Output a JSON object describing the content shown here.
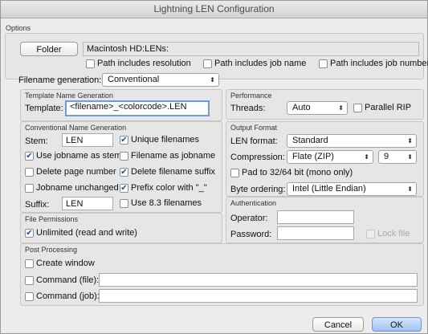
{
  "window": {
    "title": "Lightning LEN Configuration"
  },
  "options": {
    "section_label": "Options",
    "folder_button": "Folder",
    "folder_path": "Macintosh HD:LENs:",
    "path_includes_resolution": {
      "label": "Path includes resolution",
      "checked": false
    },
    "path_includes_job_name": {
      "label": "Path includes job name",
      "checked": false
    },
    "path_includes_job_number": {
      "label": "Path includes job number",
      "checked": false
    },
    "filename_generation_label": "Filename generation:",
    "filename_generation_value": "Conventional"
  },
  "template": {
    "title": "Template Name Generation",
    "label": "Template:",
    "value": "<filename>_<colorcode>.LEN"
  },
  "conventional": {
    "title": "Conventional Name Generation",
    "stem_label": "Stem:",
    "stem_value": "LEN",
    "unique_filenames": {
      "label": "Unique filenames",
      "checked": true
    },
    "use_jobname_as_stem": {
      "label": "Use jobname as stem",
      "checked": true
    },
    "filename_as_jobname": {
      "label": "Filename as jobname",
      "checked": false
    },
    "delete_page_number": {
      "label": "Delete page number",
      "checked": false
    },
    "delete_filename_suffix": {
      "label": "Delete filename suffix",
      "checked": true
    },
    "jobname_unchanged": {
      "label": "Jobname unchanged",
      "checked": false
    },
    "prefix_color": {
      "label": "Prefix color with \"_\"",
      "checked": true
    },
    "suffix_label": "Suffix:",
    "suffix_value": "LEN",
    "use_83": {
      "label": "Use 8.3 filenames",
      "checked": false
    }
  },
  "permissions": {
    "title": "File Permissions",
    "unlimited": {
      "label": "Unlimited (read and write)",
      "checked": true
    }
  },
  "performance": {
    "title": "Performance",
    "threads_label": "Threads:",
    "threads_value": "Auto",
    "parallel_rip": {
      "label": "Parallel RIP",
      "checked": false
    }
  },
  "output": {
    "title": "Output Format",
    "len_format_label": "LEN format:",
    "len_format_value": "Standard",
    "compression_label": "Compression:",
    "compression_value": "Flate (ZIP)",
    "compression_level": "9",
    "pad": {
      "label": "Pad to 32/64 bit (mono only)",
      "checked": false
    },
    "byte_ordering_label": "Byte ordering:",
    "byte_ordering_value": "Intel (Little Endian)"
  },
  "auth": {
    "title": "Authentication",
    "operator_label": "Operator:",
    "operator_value": "",
    "password_label": "Password:",
    "password_value": "",
    "lock_file": {
      "label": "Lock file",
      "checked": false
    }
  },
  "post": {
    "title": "Post Processing",
    "create_window": {
      "label": "Create window",
      "checked": false
    },
    "command_file": {
      "label": "Command (file):",
      "checked": false,
      "value": ""
    },
    "command_job": {
      "label": "Command (job):",
      "checked": false,
      "value": ""
    }
  },
  "footer": {
    "cancel": "Cancel",
    "ok": "OK"
  }
}
